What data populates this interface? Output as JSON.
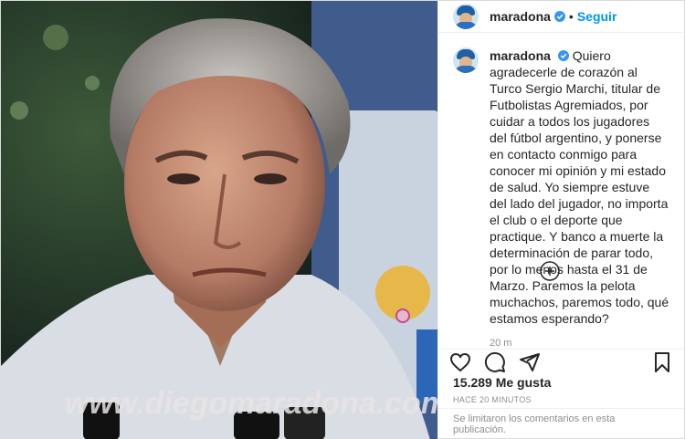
{
  "post": {
    "watermark": "www.diegomaradona.com",
    "header": {
      "username": "maradona",
      "separator": "•",
      "follow_label": "Seguir"
    },
    "caption": {
      "username": "maradona",
      "text": "Quiero agradecerle de corazón al Turco Sergio Marchi, titular de Futbolistas Agremiados, por cuidar a todos los jugadores del fútbol argentino, y ponerse en contacto conmigo para conocer mi opinión y mi estado de salud. Yo siempre estuve del lado del jugador, no importa el club o el deporte que practique. Y banco a muerte la determinación de parar todo, por lo menos hasta el 31 de Marzo. Paremos la pelota muchachos, paremos todo, qué estamos esperando?",
      "time": "20 m"
    },
    "actions": {
      "like_icon": "heart-icon",
      "comment_icon": "comment-icon",
      "share_icon": "share-icon",
      "save_icon": "bookmark-icon"
    },
    "likes": "15.289 Me gusta",
    "posted_ago": "HACE 20 MINUTOS",
    "comments_closed": "Se limitaron los comentarios en esta publicación."
  },
  "colors": {
    "link_blue": "#0095f6",
    "verified_blue": "#3897f0",
    "muted_gray": "#8e8e8e",
    "border": "#dbdbdb"
  }
}
